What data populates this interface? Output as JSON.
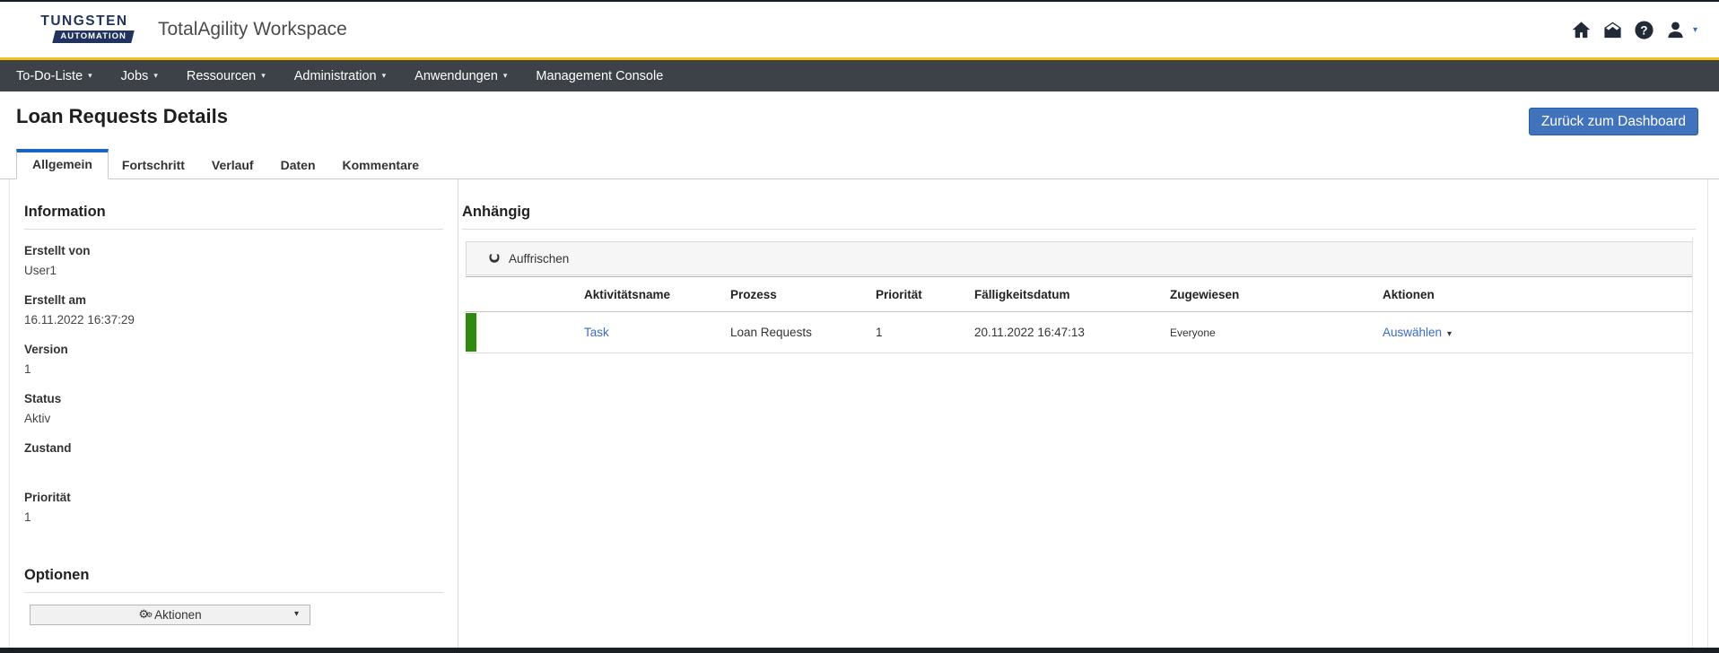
{
  "brand": {
    "logo_line1": "TUNGSTEN",
    "logo_line2": "AUTOMATION",
    "app_title": "TotalAgility Workspace"
  },
  "nav": {
    "items": [
      {
        "label": "To-Do-Liste"
      },
      {
        "label": "Jobs"
      },
      {
        "label": "Ressourcen"
      },
      {
        "label": "Administration"
      },
      {
        "label": "Anwendungen"
      },
      {
        "label": "Management Console"
      }
    ]
  },
  "page": {
    "title": "Loan Requests Details",
    "back_button_label": "Zurück zum Dashboard"
  },
  "tabs": [
    {
      "label": "Allgemein",
      "active": true
    },
    {
      "label": "Fortschritt",
      "active": false
    },
    {
      "label": "Verlauf",
      "active": false
    },
    {
      "label": "Daten",
      "active": false
    },
    {
      "label": "Kommentare",
      "active": false
    }
  ],
  "information": {
    "heading": "Information",
    "fields": [
      {
        "label": "Erstellt von",
        "value": "User1"
      },
      {
        "label": "Erstellt am",
        "value": "16.11.2022 16:37:29"
      },
      {
        "label": "Version",
        "value": "1"
      },
      {
        "label": "Status",
        "value": "Aktiv"
      },
      {
        "label": "Zustand",
        "value": ""
      },
      {
        "label": "Priorität",
        "value": "1"
      }
    ]
  },
  "options": {
    "heading": "Optionen",
    "actions_label": "Aktionen"
  },
  "pending": {
    "heading": "Anhängig",
    "refresh_label": "Auffrischen",
    "columns": [
      "Aktivitätsname",
      "Prozess",
      "Priorität",
      "Fälligkeitsdatum",
      "Zugewiesen",
      "Aktionen"
    ],
    "rows": [
      {
        "activity": "Task",
        "process": "Loan Requests",
        "priority": "1",
        "due_date": "20.11.2022 16:47:13",
        "assigned": "Everyone",
        "action_label": "Auswählen",
        "status_color": "#2E8B0D"
      }
    ]
  },
  "icons": {
    "caret_down": "▾",
    "refresh": "C",
    "gear": "⚙"
  },
  "colors": {
    "accent_gold": "#F2C216",
    "nav_bg": "#3D4249",
    "primary_button": "#4173BD",
    "active_tab_border": "#1A63C5",
    "link": "#3A6BD0",
    "row_status_green": "#2E8B0D",
    "logo_navy": "#21335F"
  }
}
